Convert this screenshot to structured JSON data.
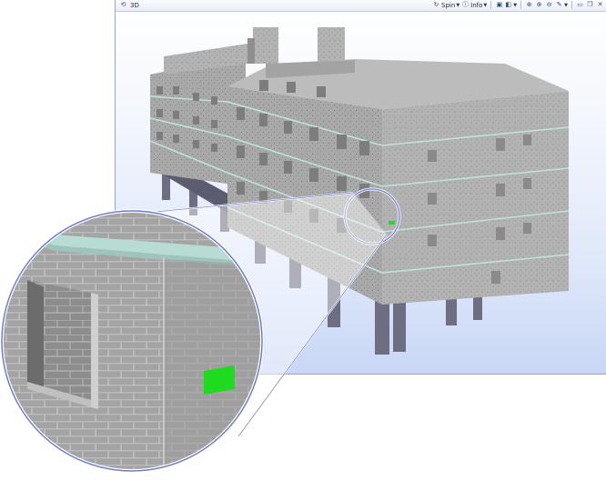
{
  "window": {
    "title": "3D",
    "title_icon": "3d-view-icon"
  },
  "toolbar": {
    "spin_label": "Spin",
    "info_label": "Info",
    "icons": [
      "spin-icon",
      "info-icon",
      "cube-icon",
      "zoom-extents-icon",
      "zoom-in-icon",
      "zoom-out-icon",
      "settings-icon",
      "minimize-icon",
      "restore-icon",
      "close-icon"
    ]
  },
  "scene": {
    "highlight_color": "#22dd22",
    "wall_color": "#a6a6a6",
    "column_color": "#6e6e82",
    "slab_edge_color": "#b8dcd4",
    "background_top": "#ffffff",
    "background_bottom": "#c9d7f6"
  }
}
